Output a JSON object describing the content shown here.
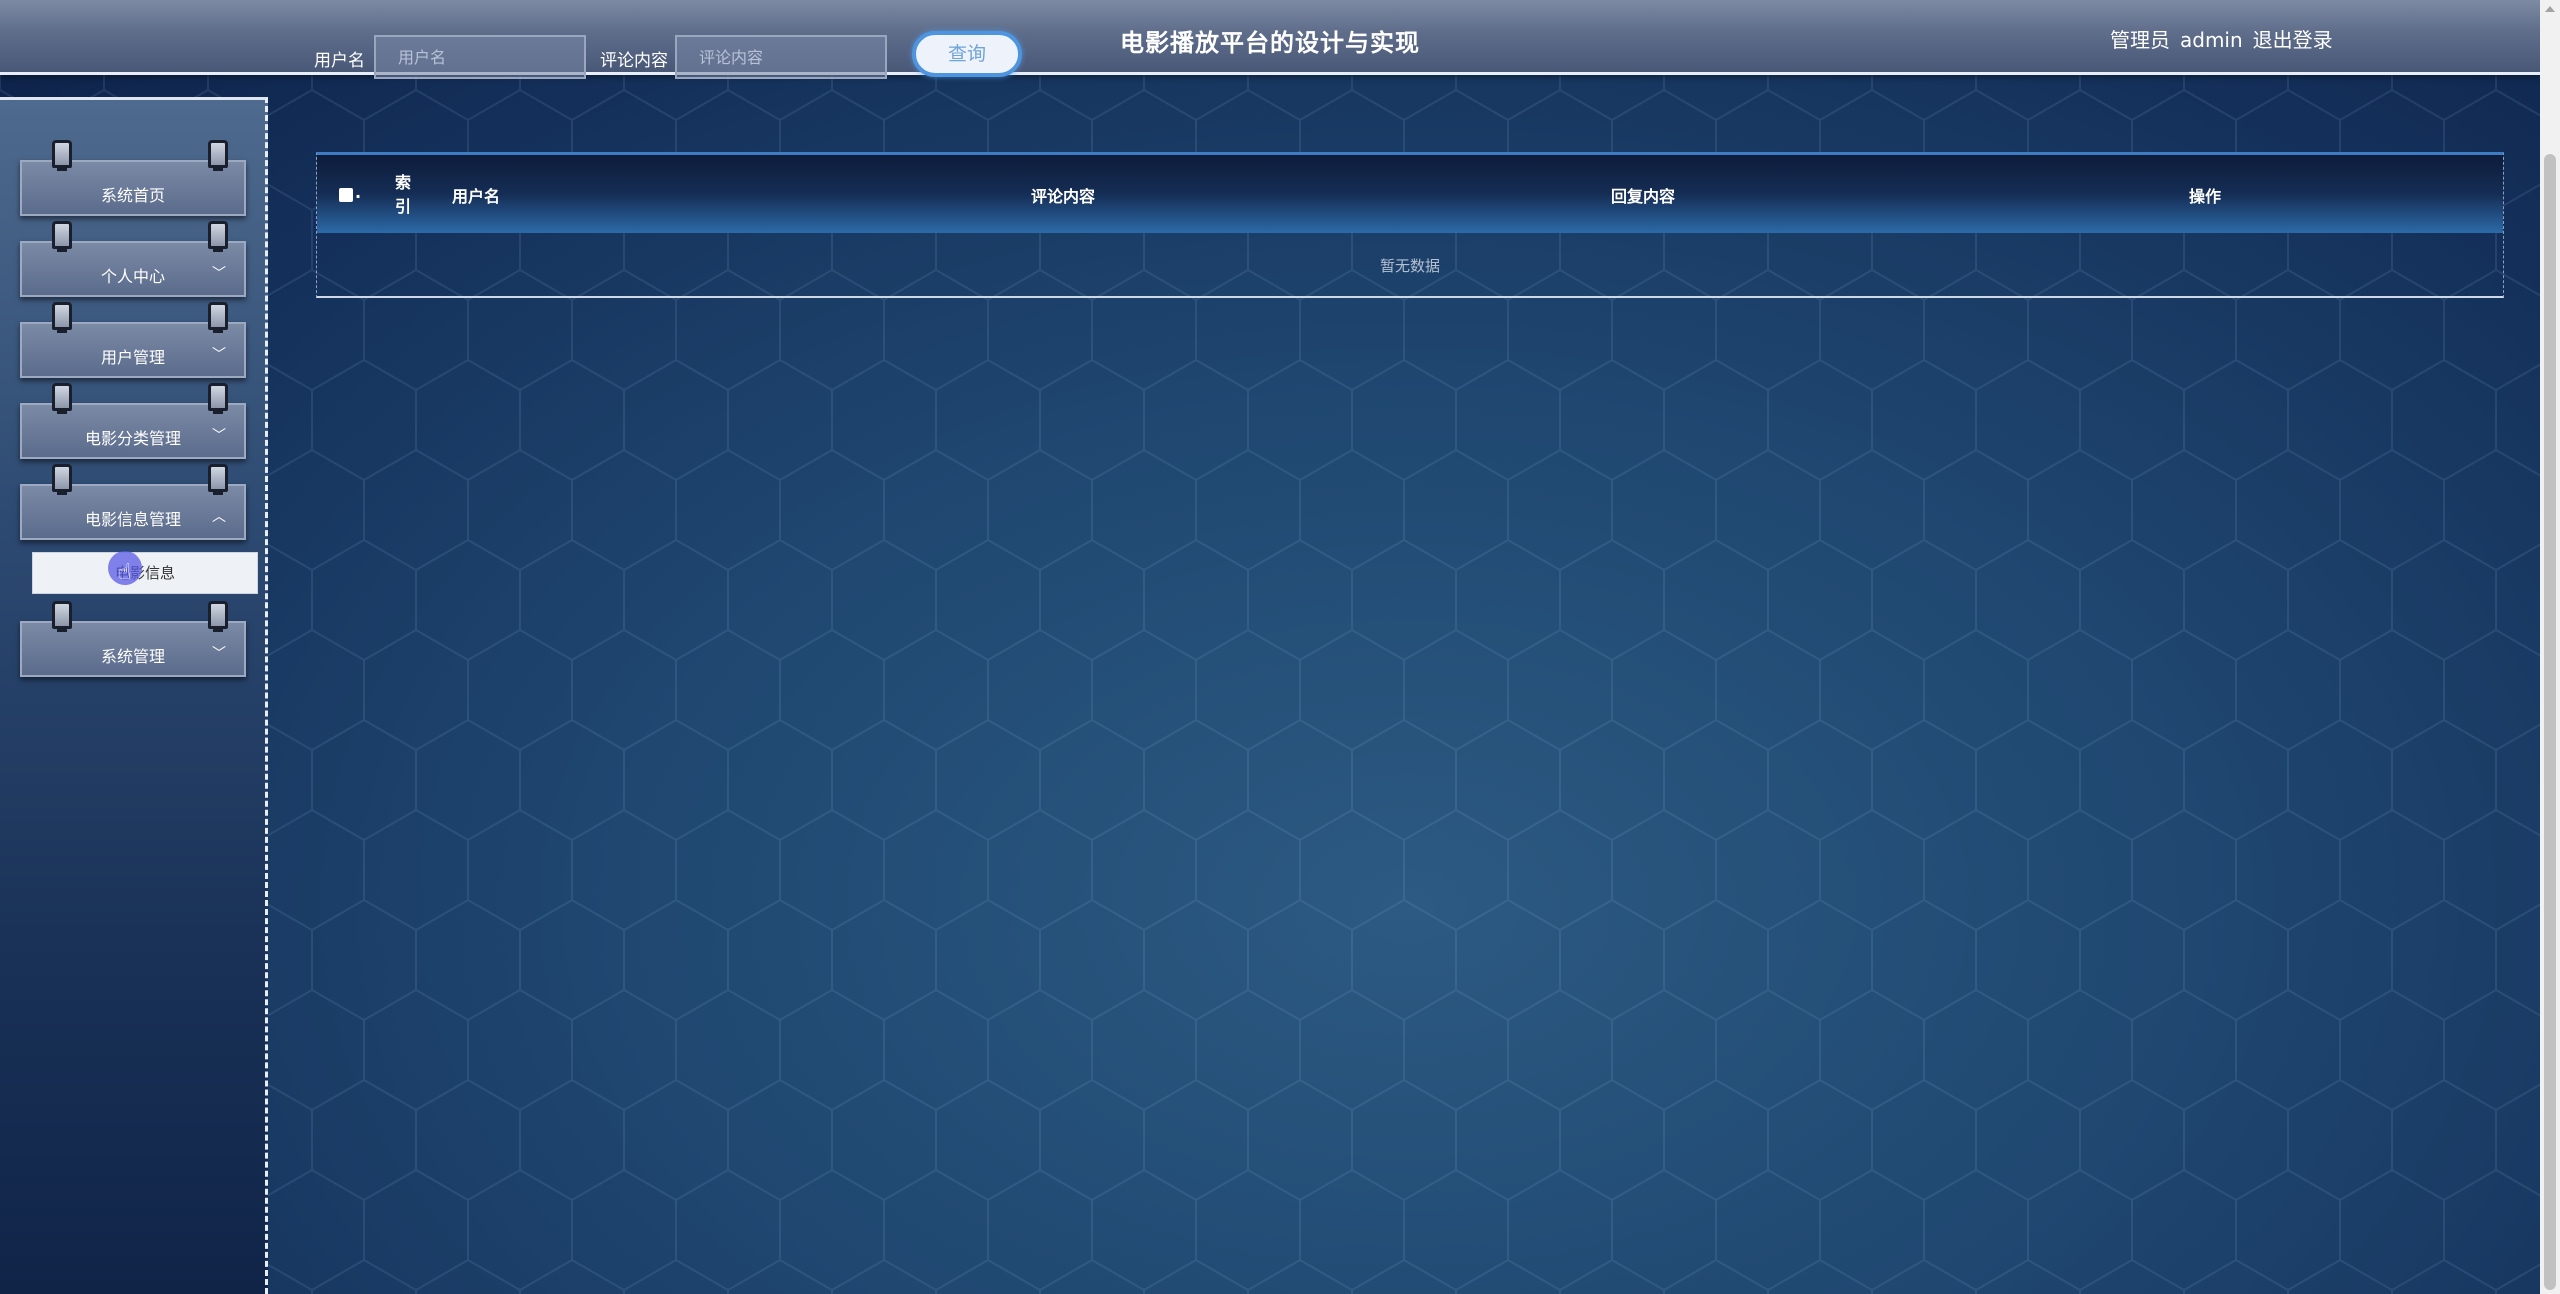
{
  "header": {
    "title": "电影播放平台的设计与实现",
    "search": {
      "username_label": "用户名",
      "username_placeholder": "用户名",
      "comment_label": "评论内容",
      "comment_placeholder": "评论内容",
      "query_button": "查询"
    },
    "user": {
      "role": "管理员",
      "name": "admin",
      "logout": "退出登录"
    }
  },
  "sidebar": {
    "items": [
      {
        "label": "系统首页",
        "has_chevron": false
      },
      {
        "label": "个人中心",
        "has_chevron": true,
        "chevron": "down"
      },
      {
        "label": "用户管理",
        "has_chevron": true,
        "chevron": "down"
      },
      {
        "label": "电影分类管理",
        "has_chevron": true,
        "chevron": "down"
      },
      {
        "label": "电影信息管理",
        "has_chevron": true,
        "chevron": "up"
      },
      {
        "label": "系统管理",
        "has_chevron": true,
        "chevron": "down"
      }
    ],
    "submenu": {
      "label": "电影信息"
    }
  },
  "table": {
    "columns": {
      "index_line1": "索",
      "index_line2": "引",
      "username": "用户名",
      "comment": "评论内容",
      "reply": "回复内容",
      "action": "操作"
    },
    "empty_text": "暂无数据"
  },
  "icons": {
    "chevron_down": "chevron-down-icon",
    "chevron_up": "chevron-up-icon",
    "clip": "binder-clip-icon"
  },
  "colors": {
    "accent": "#3c7dc3",
    "query_border": "#4e95e0"
  }
}
